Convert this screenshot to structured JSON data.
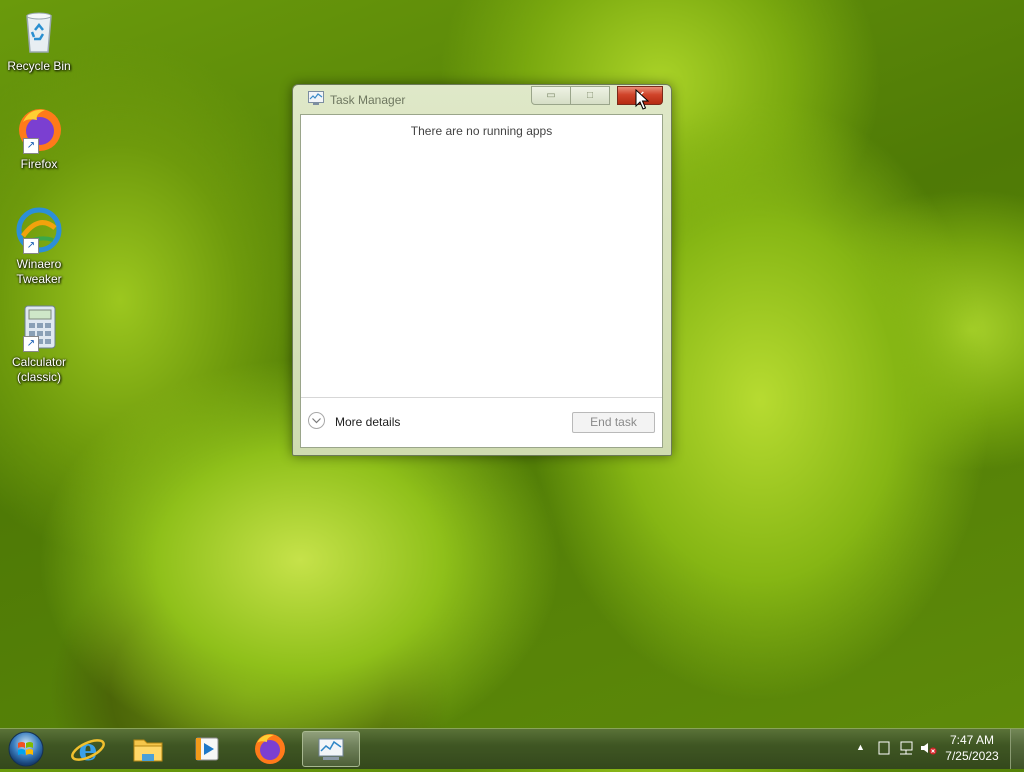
{
  "desktop": {
    "icons": [
      {
        "label": "Recycle Bin",
        "icon": "recycle-bin-icon"
      },
      {
        "label": "Firefox",
        "icon": "firefox-icon"
      },
      {
        "label": "Winaero\nTweaker",
        "icon": "winaero-tweaker-icon"
      },
      {
        "label": "Calculator\n(classic)",
        "icon": "calculator-icon"
      }
    ]
  },
  "task_manager": {
    "title": "Task Manager",
    "buttons": {
      "minimize": "▭",
      "maximize": "□",
      "close": "✕"
    },
    "empty_message": "There are no running apps",
    "more_details_label": "More details",
    "end_task_label": "End task"
  },
  "taskbar": {
    "apps": [
      {
        "name": "internet-explorer",
        "icon": "ie-icon"
      },
      {
        "name": "file-explorer",
        "icon": "folder-icon"
      },
      {
        "name": "media-player",
        "icon": "media-player-icon"
      },
      {
        "name": "firefox",
        "icon": "firefox-icon"
      },
      {
        "name": "task-manager",
        "icon": "task-manager-icon",
        "active": true
      }
    ],
    "tray": {
      "overflow": "▲",
      "time": "7:47 AM",
      "date": "7/25/2023"
    }
  },
  "colors": {
    "close_button": "#d0442a",
    "taskbar": "#3f5623"
  }
}
